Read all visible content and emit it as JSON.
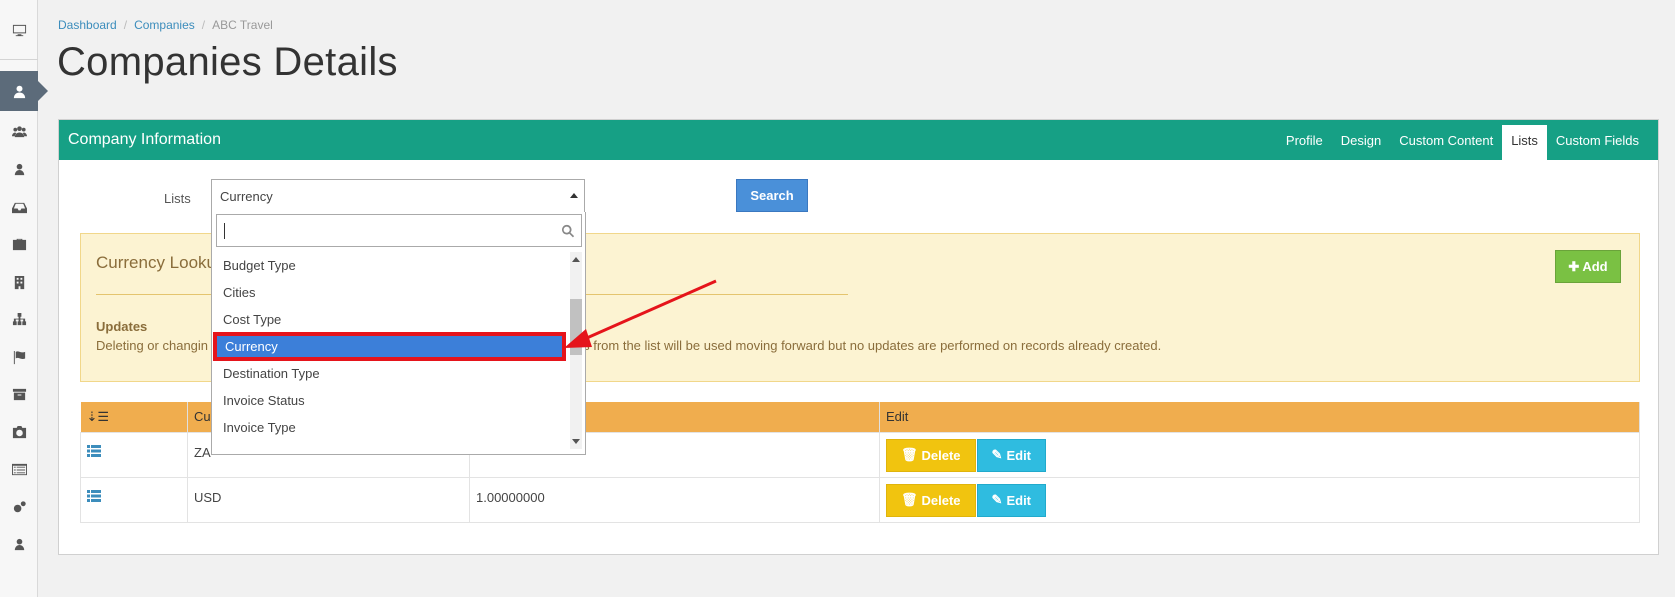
{
  "breadcrumb": {
    "dashboard": "Dashboard",
    "companies": "Companies",
    "current": "ABC Travel"
  },
  "page_title": "Companies Details",
  "panel": {
    "title": "Company Information",
    "tabs": [
      {
        "label": "Profile",
        "active": false
      },
      {
        "label": "Design",
        "active": false
      },
      {
        "label": "Custom Content",
        "active": false
      },
      {
        "label": "Lists",
        "active": true
      },
      {
        "label": "Custom Fields",
        "active": false
      }
    ]
  },
  "filter": {
    "label": "Lists",
    "selected": "Currency",
    "search_button": "Search"
  },
  "dropdown": {
    "search_value": "",
    "items": [
      "Budget Type",
      "Cities",
      "Cost Type",
      "Currency",
      "Destination Type",
      "Invoice Status",
      "Invoice Type"
    ],
    "selected_index": 3
  },
  "alert": {
    "title": "Currency Lookup",
    "subtitle": "Updates",
    "text_start": "Deleting or changin",
    "text_end": "values from the list will be used moving forward but no updates are performed on records already created.",
    "add_button": "Add"
  },
  "table": {
    "headers": [
      "",
      "Cu",
      "",
      "Edit"
    ],
    "rows": [
      {
        "code": "ZA",
        "rate": ""
      },
      {
        "code": "USD",
        "rate": "1.00000000"
      }
    ],
    "delete_label": "Delete",
    "edit_label": "Edit"
  },
  "colors": {
    "header": "#16a085",
    "accent_blue": "#4a90d9",
    "add_green": "#7ac143",
    "table_head": "#f0ad4e",
    "delete_yellow": "#f1c40f",
    "edit_cyan": "#2fbce0",
    "annotation_red": "#e5141b"
  }
}
